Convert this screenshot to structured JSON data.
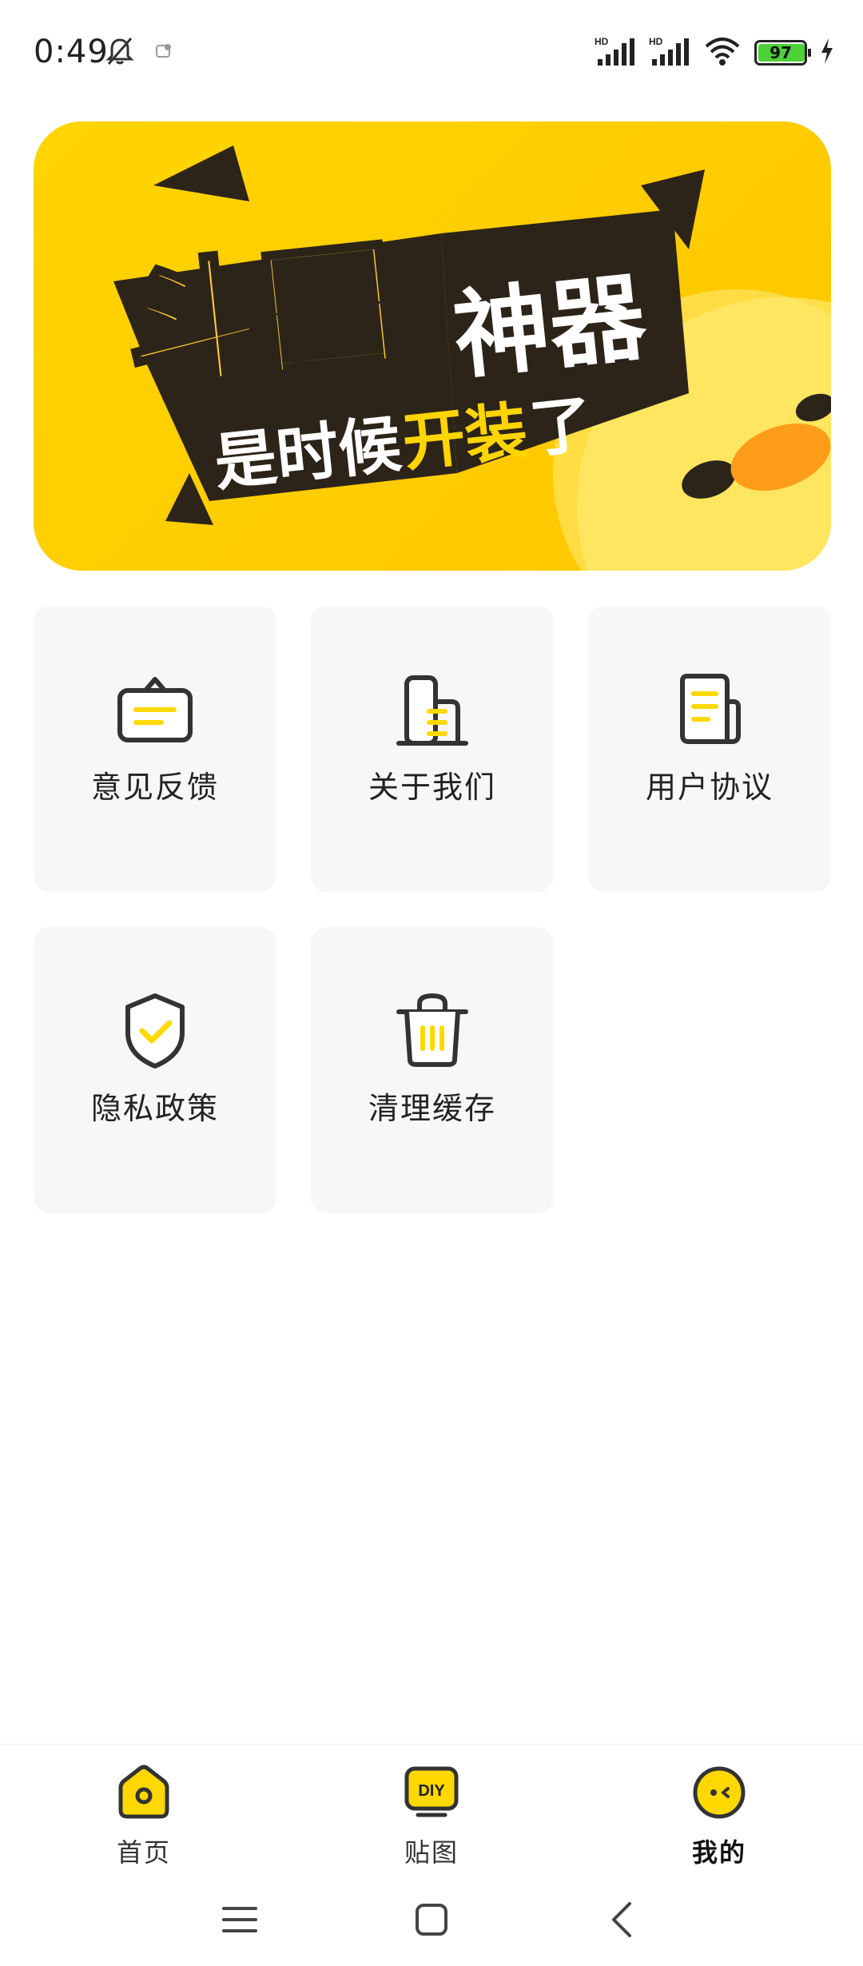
{
  "status_bar": {
    "time": "0:49",
    "battery": "97",
    "signal_label_1": "HD",
    "signal_label_2": "HD"
  },
  "banner": {
    "title_part1": "斗图",
    "title_part2": "神器",
    "subtitle_part1": "是时候",
    "subtitle_part2": "开装",
    "subtitle_part3": "了"
  },
  "menu": {
    "items": [
      {
        "label": "意见反馈",
        "icon": "feedback-icon"
      },
      {
        "label": "关于我们",
        "icon": "building-icon"
      },
      {
        "label": "用户协议",
        "icon": "document-icon"
      },
      {
        "label": "隐私政策",
        "icon": "shield-icon"
      },
      {
        "label": "清理缓存",
        "icon": "trash-icon"
      }
    ]
  },
  "tabbar": {
    "tabs": [
      {
        "label": "首页",
        "icon": "home-icon",
        "active": false
      },
      {
        "label": "贴图",
        "icon": "diy-icon",
        "badge": "DIY",
        "active": false
      },
      {
        "label": "我的",
        "icon": "face-icon",
        "active": true
      }
    ]
  },
  "colors": {
    "accent": "#ffd800",
    "card_bg": "#f7f7f7",
    "icon_stroke": "#333333"
  }
}
